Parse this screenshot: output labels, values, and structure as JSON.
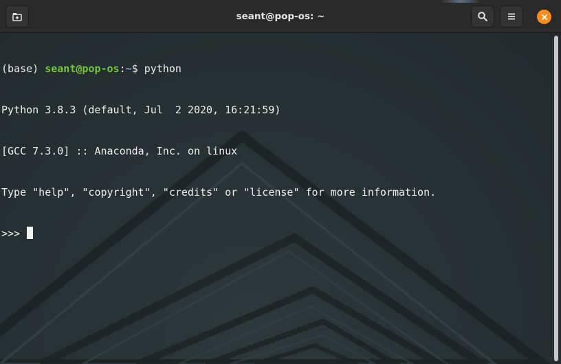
{
  "window": {
    "title": "seant@pop-os: ~"
  },
  "header": {
    "new_tab_icon": "new-tab-icon",
    "search_icon": "search-icon",
    "menu_icon": "hamburger-menu-icon",
    "close_icon": "close-icon",
    "close_color": "#fb8c1d"
  },
  "terminal": {
    "prompt_env": "(base) ",
    "prompt_user_host": "seant@pop-os",
    "prompt_colon": ":",
    "prompt_path": "~",
    "prompt_symbol": "$ ",
    "command": "python",
    "output": [
      "Python 3.8.3 (default, Jul  2 2020, 16:21:59)",
      "[GCC 7.3.0] :: Anaconda, Inc. on linux",
      "Type \"help\", \"copyright\", \"credits\" or \"license\" for more information."
    ],
    "repl_prompt": ">>> ",
    "colors": {
      "text": "#f0f0f0",
      "user_host": "#73c936",
      "path": "#6fa7d9",
      "background": "#263033"
    }
  },
  "scrollbar": {
    "position_fraction": 0.0
  }
}
